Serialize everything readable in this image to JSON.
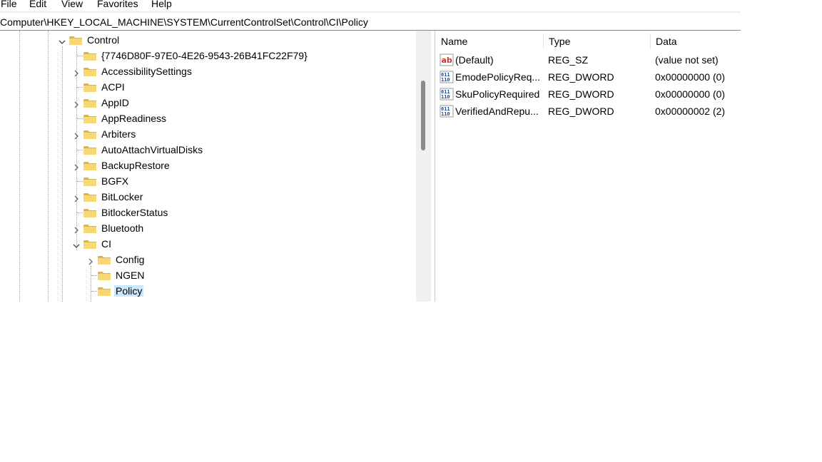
{
  "menu": {
    "file": "File",
    "edit": "Edit",
    "view": "View",
    "favorites": "Favorites",
    "help": "Help"
  },
  "address": {
    "path": "Computer\\HKEY_LOCAL_MACHINE\\SYSTEM\\CurrentControlSet\\Control\\CI\\Policy"
  },
  "tree": {
    "nodes": [
      {
        "label": "Control",
        "expanded": true
      },
      {
        "label": "{7746D80F-97E0-4E26-9543-26B41FC22F79}",
        "expanded": false
      },
      {
        "label": "AccessibilitySettings",
        "expanded": false
      },
      {
        "label": "ACPI",
        "expanded": false
      },
      {
        "label": "AppID",
        "expanded": false
      },
      {
        "label": "AppReadiness",
        "expanded": false
      },
      {
        "label": "Arbiters",
        "expanded": false
      },
      {
        "label": "AutoAttachVirtualDisks",
        "expanded": false
      },
      {
        "label": "BackupRestore",
        "expanded": false
      },
      {
        "label": "BGFX",
        "expanded": false
      },
      {
        "label": "BitLocker",
        "expanded": false
      },
      {
        "label": "BitlockerStatus",
        "expanded": false
      },
      {
        "label": "Bluetooth",
        "expanded": false
      },
      {
        "label": "CI",
        "expanded": true
      },
      {
        "label": "Config",
        "expanded": false
      },
      {
        "label": "NGEN",
        "expanded": false
      },
      {
        "label": "Policy",
        "expanded": false,
        "selected": true
      }
    ]
  },
  "list": {
    "columns": {
      "name": "Name",
      "type": "Type",
      "data": "Data"
    },
    "rows": [
      {
        "name": "(Default)",
        "type": "REG_SZ",
        "data": "(value not set)",
        "icon": "string-value-icon"
      },
      {
        "name": "EmodePolicyReq...",
        "type": "REG_DWORD",
        "data": "0x00000000 (0)",
        "icon": "binary-value-icon"
      },
      {
        "name": "SkuPolicyRequired",
        "type": "REG_DWORD",
        "data": "0x00000000 (0)",
        "icon": "binary-value-icon"
      },
      {
        "name": "VerifiedAndRepu...",
        "type": "REG_DWORD",
        "data": "0x00000002 (2)",
        "icon": "binary-value-icon"
      }
    ]
  },
  "colors": {
    "folder": "#f8d775",
    "folder_dark": "#e8b13b",
    "selection": "#cce8ff"
  }
}
